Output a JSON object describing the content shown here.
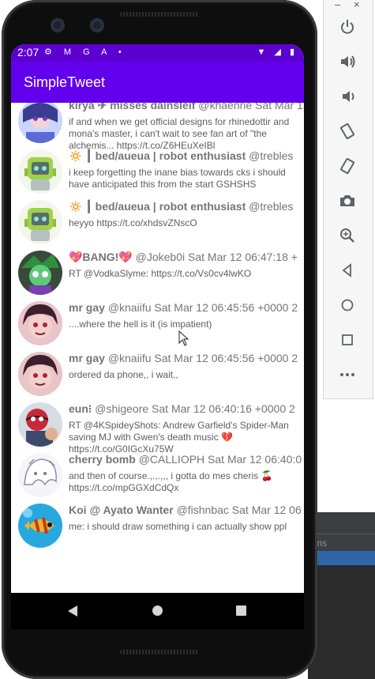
{
  "status_bar": {
    "time": "2:07"
  },
  "app_bar": {
    "title": "SimpleTweet"
  },
  "tweets": [
    {
      "name": "kirya ✈ misses dainsleif",
      "meta": "@khaenrie Sat Mar 12",
      "body": "if and when we get official designs for rhinedottir and mona's master, i can't wait to see fan art of \"the alchemis... https://t.co/Z6HEuXeIBl",
      "avatar_color": "#c9d6ff"
    },
    {
      "name": "🔅 ┃ bed/aueua | robot enthusiast",
      "meta": "@trebles",
      "body": "i keep forgetting the inane bias towards cks i should have anticipated this from the start GSHSHS",
      "avatar_color": "#b8e07a"
    },
    {
      "name": "🔅 ┃ bed/aueua | robot enthusiast",
      "meta": "@trebles",
      "body": "heyyo https://t.co/xhdsvZNscO",
      "avatar_color": "#b8e07a"
    },
    {
      "name": "💖BANG!💖",
      "meta": "@Jokeb0i Sat Mar 12 06:47:18 +",
      "body": "RT @VodkaSlyme: https://t.co/Vs0cv4lwKO",
      "avatar_color": "#3c6b3c"
    },
    {
      "name": "mr gay",
      "meta": "@knaiifu Sat Mar 12 06:45:56 +0000 2",
      "body": "....where the hell is it (is impatient)",
      "avatar_color": "#e8a0a8"
    },
    {
      "name": "mr gay",
      "meta": "@knaiifu Sat Mar 12 06:45:56 +0000 2",
      "body": "ordered da phone,, i wait,,",
      "avatar_color": "#e8a0a8"
    },
    {
      "name": "eun⁝",
      "meta": "@shigeore Sat Mar 12 06:40:16 +0000 2",
      "body": "RT @4KSpideyShots: Andrew Garfield's Spider-Man saving MJ with Gwen's death music 💔 https://t.co/G0IGcXu75W",
      "avatar_color": "#5a6a86"
    },
    {
      "name": "cherry bomb",
      "meta": "@CALLIOPH Sat Mar 12 06:40:0",
      "body": "and then of course.,.,.,,, i gotta do mes cheris 🍒 https://t.co/mpGGXdCdQx",
      "avatar_color": "#e4e8f0"
    },
    {
      "name": "Koi @ Ayato Wanter",
      "meta": "@fishnbac Sat Mar 12 06",
      "body": "me: i should draw something i can actually show ppl",
      "avatar_color": "#29a8e0"
    }
  ],
  "emulator": {
    "window_buttons": [
      "–",
      "×"
    ],
    "tools": [
      "power-icon",
      "volume-up-icon",
      "volume-down-icon",
      "rotate-left-icon",
      "rotate-right-icon",
      "camera-icon",
      "zoom-icon",
      "back-icon",
      "home-icon",
      "overview-icon",
      "more-icon"
    ]
  },
  "background": {
    "panel_text": "ms"
  }
}
